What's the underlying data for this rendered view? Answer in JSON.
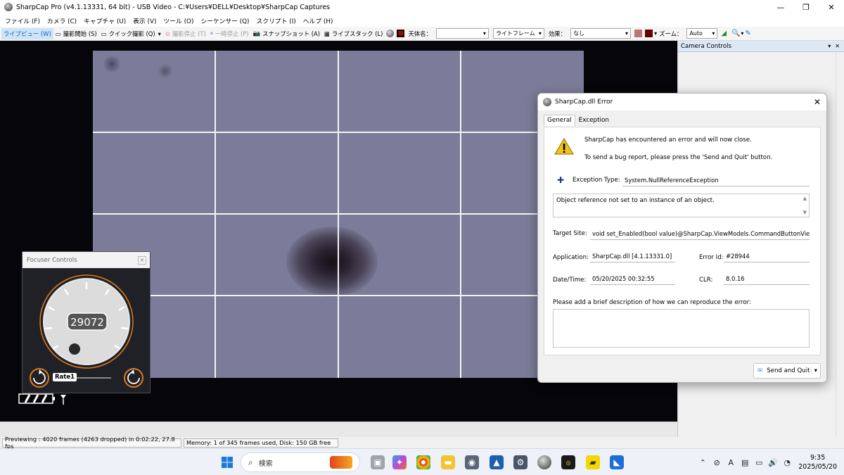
{
  "window": {
    "title": "SharpCap Pro (v4.1.13331, 64 bit) - USB Video - C:¥Users¥DELL¥Desktop¥SharpCap Captures",
    "controls": {
      "minimize": "—",
      "maximize": "❐",
      "close": "✕"
    }
  },
  "menu": {
    "items": [
      "ファイル (F)",
      "カメラ (C)",
      "キャプチャ (U)",
      "表示 (V)",
      "ツール (O)",
      "シーケンサー (Q)",
      "スクリプト (I)",
      "ヘルプ (H)"
    ]
  },
  "toolbar": {
    "live_view": "ライブビュー (W)",
    "start_capture": "撮影開始 (S)",
    "quick_capture": "クイック撮影 (Q)",
    "stop_capture": "撮影停止 (T)",
    "pause": "一時停止 (P)",
    "snapshot": "スナップショット (A)",
    "live_stack": "ライブスタック (L)",
    "target_label": "天体名：",
    "target_value": "",
    "frame_type": "ライトフレーム",
    "effect_label": "効果：",
    "effect_value": "なし",
    "zoom_label": "ズーム：",
    "zoom_value": "Auto"
  },
  "right_panel": {
    "title": "Camera Controls"
  },
  "focuser": {
    "title": "Focuser Controls",
    "position": "29072",
    "rate_label": "Rate1"
  },
  "dialog": {
    "title": "SharpCap.dll Error",
    "tabs": [
      "General",
      "Exception"
    ],
    "message_line1": "SharpCap has encountered an error and will now close.",
    "message_line2": "To send a bug report, please press the 'Send and Quit' button.",
    "exception_type_label": "Exception Type:",
    "exception_type_value": "System.NullReferenceException",
    "exception_message": "Object reference not set to an instance of an object.",
    "target_site_label": "Target Site:",
    "target_site_value": "void set_Enabled(bool value)@SharpCap.ViewModels.CommandButtonVie",
    "application_label": "Application:",
    "application_value": "SharpCap.dll [4.1.13331.0]",
    "error_id_label": "Error Id:",
    "error_id_value": "#28944",
    "datetime_label": "Date/Time:",
    "datetime_value": "05/20/2025 00:32:55",
    "clr_label": "CLR:",
    "clr_value": "8.0.16",
    "describe_label": "Please add a brief description of how we can reproduce the error:",
    "describe_value": "",
    "send_button": "Send and Quit"
  },
  "status": {
    "previewing": "Previewing : 4020 frames (4263 dropped) in 0:02:22, 27.8 fps",
    "memory": "Memory: 1 of 345 frames used, Disk: 150 GB free"
  },
  "taskbar": {
    "search_placeholder": "検索",
    "time": "9:35",
    "date": "2025/05/20",
    "ime": "A"
  }
}
